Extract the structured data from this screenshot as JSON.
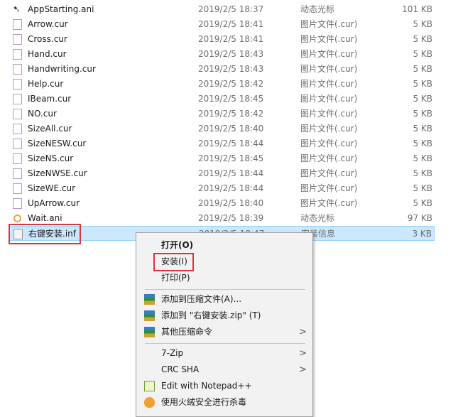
{
  "files": [
    {
      "name": "AppStarting.ani",
      "date": "2019/2/5 18:37",
      "type": "动态光标",
      "size": "101 KB",
      "icon": "animated-cursor-icon"
    },
    {
      "name": "Arrow.cur",
      "date": "2019/2/5 18:41",
      "type": "图片文件(.cur)",
      "size": "5 KB",
      "icon": "image-file-icon"
    },
    {
      "name": "Cross.cur",
      "date": "2019/2/5 18:41",
      "type": "图片文件(.cur)",
      "size": "5 KB",
      "icon": "image-file-icon"
    },
    {
      "name": "Hand.cur",
      "date": "2019/2/5 18:43",
      "type": "图片文件(.cur)",
      "size": "5 KB",
      "icon": "image-file-icon"
    },
    {
      "name": "Handwriting.cur",
      "date": "2019/2/5 18:43",
      "type": "图片文件(.cur)",
      "size": "5 KB",
      "icon": "image-file-icon"
    },
    {
      "name": "Help.cur",
      "date": "2019/2/5 18:42",
      "type": "图片文件(.cur)",
      "size": "5 KB",
      "icon": "image-file-icon"
    },
    {
      "name": "IBeam.cur",
      "date": "2019/2/5 18:45",
      "type": "图片文件(.cur)",
      "size": "5 KB",
      "icon": "image-file-icon"
    },
    {
      "name": "NO.cur",
      "date": "2019/2/5 18:42",
      "type": "图片文件(.cur)",
      "size": "5 KB",
      "icon": "image-file-icon"
    },
    {
      "name": "SizeAll.cur",
      "date": "2019/2/5 18:40",
      "type": "图片文件(.cur)",
      "size": "5 KB",
      "icon": "image-file-icon"
    },
    {
      "name": "SizeNESW.cur",
      "date": "2019/2/5 18:44",
      "type": "图片文件(.cur)",
      "size": "5 KB",
      "icon": "image-file-icon"
    },
    {
      "name": "SizeNS.cur",
      "date": "2019/2/5 18:45",
      "type": "图片文件(.cur)",
      "size": "5 KB",
      "icon": "image-file-icon"
    },
    {
      "name": "SizeNWSE.cur",
      "date": "2019/2/5 18:44",
      "type": "图片文件(.cur)",
      "size": "5 KB",
      "icon": "image-file-icon"
    },
    {
      "name": "SizeWE.cur",
      "date": "2019/2/5 18:44",
      "type": "图片文件(.cur)",
      "size": "5 KB",
      "icon": "image-file-icon"
    },
    {
      "name": "UpArrow.cur",
      "date": "2019/2/5 18:40",
      "type": "图片文件(.cur)",
      "size": "5 KB",
      "icon": "image-file-icon"
    },
    {
      "name": "Wait.ani",
      "date": "2019/2/5 18:39",
      "type": "动态光标",
      "size": "97 KB",
      "icon": "animated-cursor-icon"
    },
    {
      "name": "右键安装.inf",
      "date": "2019/2/5 18:47",
      "type": "安装信息",
      "size": "3 KB",
      "icon": "setup-info-icon",
      "selected": true
    }
  ],
  "menu": [
    {
      "label": "打开(O)",
      "bold": true
    },
    {
      "label": "安装(I)",
      "highlighted": true
    },
    {
      "label": "打印(P)"
    },
    {
      "label": "添加到压缩文件(A)...",
      "icon": "winrar-icon"
    },
    {
      "label": "添加到 \"右键安装.zip\" (T)",
      "icon": "winrar-icon"
    },
    {
      "label": "其他压缩命令",
      "icon": "winrar-icon",
      "submenu": true
    },
    {
      "label": "7-Zip",
      "submenu": true
    },
    {
      "label": "CRC SHA",
      "submenu": true
    },
    {
      "label": "Edit with Notepad++",
      "icon": "notepad-plus-plus-icon"
    },
    {
      "label": "使用火绒安全进行杀毒",
      "icon": "huorong-shield-icon"
    }
  ],
  "colors": {
    "selection": "#cce8ff",
    "highlight_box": "#d9363e"
  }
}
